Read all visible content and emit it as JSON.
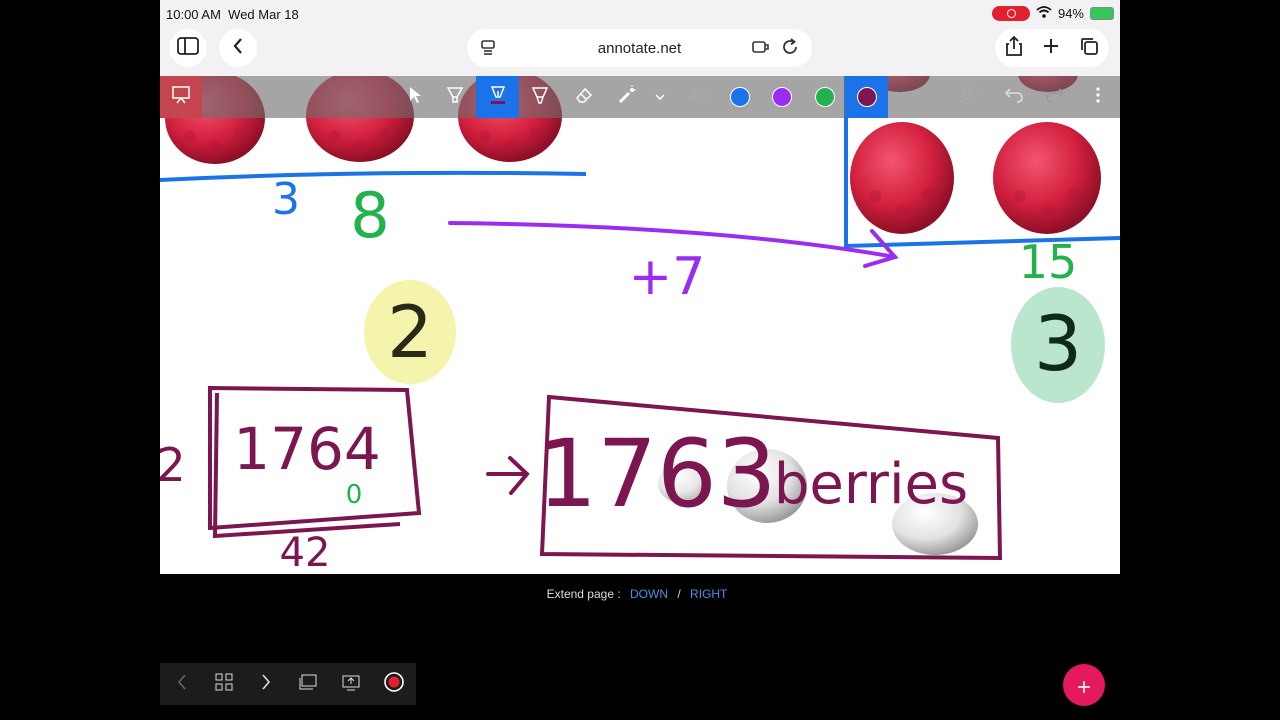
{
  "status": {
    "time": "10:00 AM",
    "date": "Wed Mar 18",
    "battery": "94%"
  },
  "browser": {
    "url": "annotate.net"
  },
  "toolbar": {
    "colors": [
      "#1a73e8",
      "#9b2cf2",
      "#22b14c",
      "#7b1651"
    ]
  },
  "canvas": {
    "labels": {
      "n3": "3",
      "n8": "8",
      "plus7": "+7",
      "n15": "15",
      "circle2": "2",
      "circle3": "3",
      "n2": "2",
      "n1764": "1764",
      "n0": "0",
      "n42": "42",
      "n1763": "1763",
      "berries": "berries"
    }
  },
  "footer": {
    "extend_label": "Extend page :",
    "down": "DOWN",
    "sep": "/",
    "right": "RIGHT"
  }
}
